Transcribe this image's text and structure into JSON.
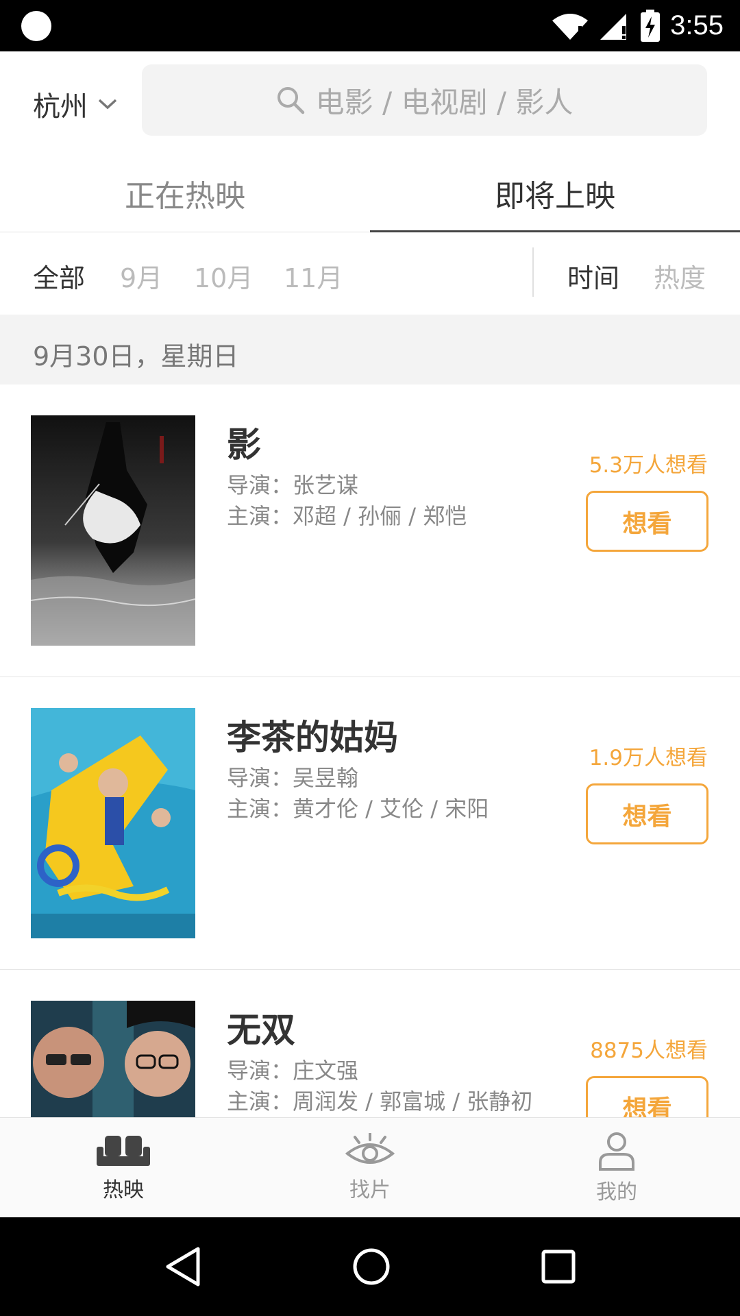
{
  "status_bar": {
    "time": "3:55",
    "icons": [
      "wifi-icon",
      "signal-icon",
      "battery-charging-icon"
    ]
  },
  "header": {
    "city": "杭州",
    "search_placeholder": "电影 / 电视剧 / 影人"
  },
  "tabs": [
    {
      "label": "正在热映",
      "active": false
    },
    {
      "label": "即将上映",
      "active": true
    }
  ],
  "filters": {
    "months": [
      "全部",
      "9月",
      "10月",
      "11月"
    ],
    "sort": [
      "时间",
      "热度"
    ]
  },
  "date_header": "9月30日，星期日",
  "movies": [
    {
      "title": "影",
      "director": "导演：张艺谋",
      "cast": "主演：邓超 / 孙俪 / 郑恺",
      "want_count": "5.3万人想看",
      "button": "想看"
    },
    {
      "title": "李茶的姑妈",
      "director": "导演：吴昱翰",
      "cast": "主演：黄才伦 / 艾伦 / 宋阳",
      "want_count": "1.9万人想看",
      "button": "想看"
    },
    {
      "title": "无双",
      "director": "导演：庄文强",
      "cast": "主演：周润发 / 郭富城 / 张静初",
      "want_count": "8875人想看",
      "button": "想看"
    }
  ],
  "bottom_nav": [
    {
      "label": "热映",
      "icon": "sofa-icon",
      "active": true
    },
    {
      "label": "找片",
      "icon": "eye-icon",
      "active": false
    },
    {
      "label": "我的",
      "icon": "person-icon",
      "active": false
    }
  ],
  "system_nav": [
    "back-icon",
    "home-icon",
    "recents-icon"
  ],
  "colors": {
    "accent": "#f4a63b",
    "tab_indicator": "#444444",
    "section_bg": "#f3f3f3"
  }
}
